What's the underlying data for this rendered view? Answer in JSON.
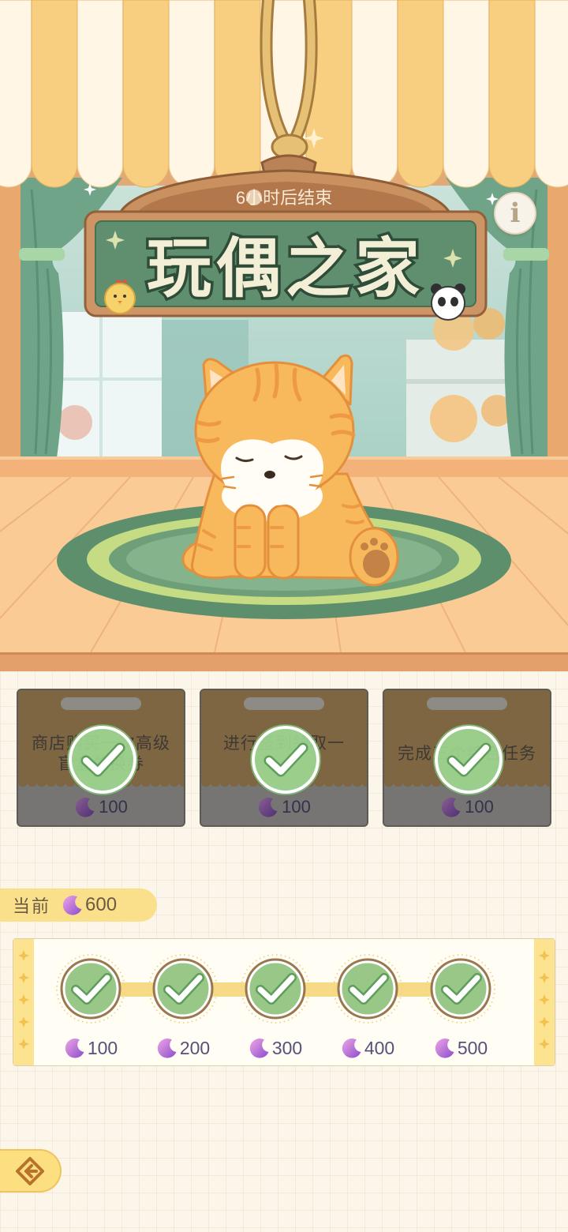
{
  "event": {
    "countdown": "6小时后结束",
    "title": "玩偶之家"
  },
  "info_button": {
    "label": "i",
    "icon": "info-icon"
  },
  "tasks": [
    {
      "lines": [
        "商店购买一次高级",
        "盲盒兑换券"
      ],
      "reward": "100",
      "completed": true
    },
    {
      "lines": [
        "进行签到领取一"
      ],
      "reward": "100",
      "completed": true
    },
    {
      "lines": [
        "完成三个综合任务"
      ],
      "reward": "100",
      "completed": true
    }
  ],
  "current": {
    "label": "当前",
    "value": "600",
    "currency_icon": "moon-icon"
  },
  "milestones": [
    {
      "value": "100",
      "claimed": true
    },
    {
      "value": "200",
      "claimed": true
    },
    {
      "value": "300",
      "claimed": true
    },
    {
      "value": "400",
      "claimed": true
    },
    {
      "value": "500",
      "claimed": true
    }
  ],
  "back_button": {
    "icon": "back-arrow-icon"
  },
  "colors": {
    "awning_yellow": "#F8CE80",
    "sign_green": "#5F8F6E",
    "accent_yellow": "#FBE08C",
    "check_green": "#9ED894",
    "moon_purple": "#B36BD6"
  }
}
